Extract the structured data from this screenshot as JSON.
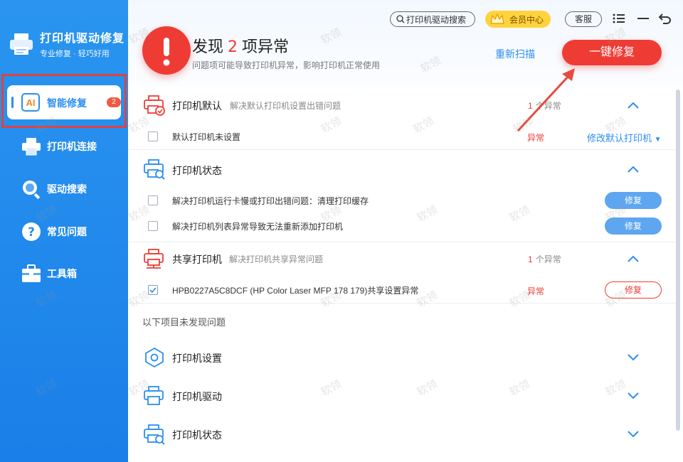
{
  "app": {
    "title": "打印机驱动修复",
    "subtitle": "专业修复 · 轻巧好用"
  },
  "sidebar": {
    "items": [
      {
        "label": "智能修复",
        "badge": "2",
        "active": true,
        "icon": "ai-icon"
      },
      {
        "label": "打印机连接",
        "icon": "printer-icon"
      },
      {
        "label": "驱动搜索",
        "icon": "search-icon"
      },
      {
        "label": "常见问题",
        "icon": "question-icon"
      },
      {
        "label": "工具箱",
        "icon": "toolbox-icon"
      }
    ]
  },
  "toolbar": {
    "search_label": "打印机驱动搜索",
    "vip_label": "会员中心",
    "service_label": "客服"
  },
  "summary": {
    "prefix": "发现",
    "count": "2",
    "suffix": "项异常",
    "desc": "问题项可能导致打印机异常，影响打印机正常使用",
    "rescan": "重新扫描",
    "fix_all": "一键修复"
  },
  "sections": [
    {
      "title": "打印机默认",
      "desc": "解决默认打印机设置出错问题",
      "count": "1",
      "count_unit": "个异常",
      "items": [
        {
          "text": "默认打印机未设置",
          "status": "异常",
          "action": "修改默认打印机"
        }
      ]
    },
    {
      "title": "打印机状态",
      "items": [
        {
          "text": "解决打印机运行卡慢或打印出错问题：清理打印缓存",
          "action": "修复"
        },
        {
          "text": "解决打印机列表异常导致无法重新添加打印机",
          "action": "修复"
        }
      ]
    },
    {
      "title": "共享打印机",
      "desc": "解决打印机共享异常问题",
      "count": "1",
      "count_unit": "个异常",
      "items": [
        {
          "text": "HPB0227A5C8DCF (HP Color Laser MFP 178 179)共享设置异常",
          "status": "异常",
          "action": "修复",
          "checked": true
        }
      ]
    }
  ],
  "ok_heading": "以下项目未发现问题",
  "ok_sections": [
    {
      "title": "打印机设置"
    },
    {
      "title": "打印机驱动"
    },
    {
      "title": "打印机状态"
    }
  ],
  "watermark": "软领",
  "colors": {
    "brand_blue": "#2a8ef0",
    "alert_red": "#ee3c35",
    "vip_gold": "#ffd33d"
  }
}
